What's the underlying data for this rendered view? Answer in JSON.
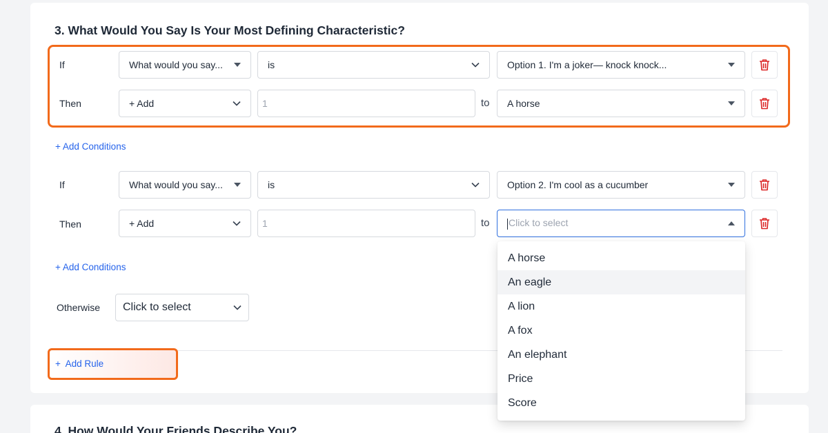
{
  "question3": {
    "title": "3. What Would You Say Is Your Most Defining Characteristic?",
    "rule1": {
      "if_label": "If",
      "if_field": "What would you say...",
      "if_operator": "is",
      "if_value": "Option 1. I'm a joker— knock knock...",
      "then_label": "Then",
      "then_action": "+ Add",
      "then_amount_placeholder": "1",
      "to_label": "to",
      "then_target": "A horse"
    },
    "add_conditions_1": "+ Add Conditions",
    "rule2": {
      "if_label": "If",
      "if_field": "What would you say...",
      "if_operator": "is",
      "if_value": "Option 2. I'm cool as a cucumber",
      "then_label": "Then",
      "then_action": "+ Add",
      "then_amount_placeholder": "1",
      "to_label": "to",
      "then_target_placeholder": "Click to select"
    },
    "add_conditions_2": "+ Add Conditions",
    "otherwise_label": "Otherwise",
    "otherwise_value": "Click to select",
    "add_rule": "+  Add Rule"
  },
  "dropdown": {
    "options": [
      "A horse",
      "An eagle",
      "A lion",
      "A fox",
      "An elephant",
      "Price",
      "Score"
    ],
    "hovered_option": "An eagle"
  },
  "question4": {
    "title": "4. How Would Your Friends Describe You?"
  },
  "colors": {
    "highlight": "#f26a1b",
    "link": "#2563eb",
    "delete_icon": "#dc2626",
    "focus_border": "#2f6fde"
  },
  "icons": {
    "delete": "trash-icon",
    "select_caret": "caret-down-icon",
    "select_chevron": "chevron-down-icon",
    "open_caret": "caret-up-icon"
  }
}
